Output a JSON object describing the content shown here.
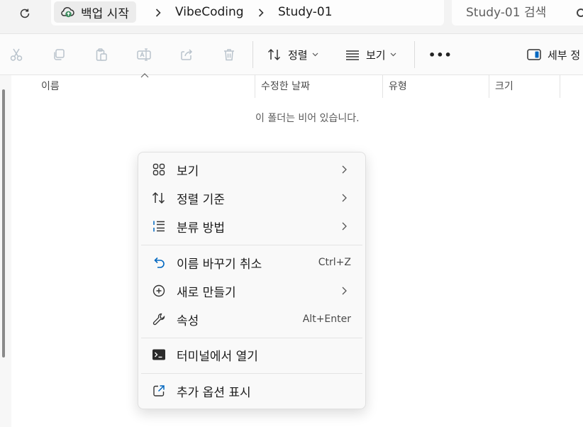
{
  "address_bar": {
    "breadcrumbs": [
      "백업 시작",
      "VibeCoding",
      "Study-01"
    ],
    "search_placeholder": "Study-01 검색"
  },
  "command_bar": {
    "sort_label": "정렬",
    "view_label": "보기",
    "more_label": "•••",
    "details_label": "세부 정"
  },
  "columns": [
    "이름",
    "수정한 날짜",
    "유형",
    "크기"
  ],
  "empty_message": "이 폴더는 비어 있습니다.",
  "context_menu": {
    "items": [
      {
        "label": "보기",
        "icon": "grid-icon",
        "submenu": true
      },
      {
        "label": "정렬 기준",
        "icon": "sort-arrows-icon",
        "submenu": true
      },
      {
        "label": "분류 방법",
        "icon": "group-list-icon",
        "submenu": true
      },
      {
        "label": "이름 바꾸기 취소",
        "icon": "undo-icon",
        "shortcut": "Ctrl+Z"
      },
      {
        "label": "새로 만들기",
        "icon": "plus-circle-icon",
        "submenu": true
      },
      {
        "label": "속성",
        "icon": "wrench-icon",
        "shortcut": "Alt+Enter"
      },
      {
        "label": "터미널에서 열기",
        "icon": "terminal-icon"
      },
      {
        "label": "추가 옵션 표시",
        "icon": "external-link-icon"
      }
    ]
  },
  "colors": {
    "accent": "#0067c0",
    "text": "#1b1b1b",
    "disabled_icon": "#b9c3cc",
    "menu_bg": "#f9f9f9"
  }
}
